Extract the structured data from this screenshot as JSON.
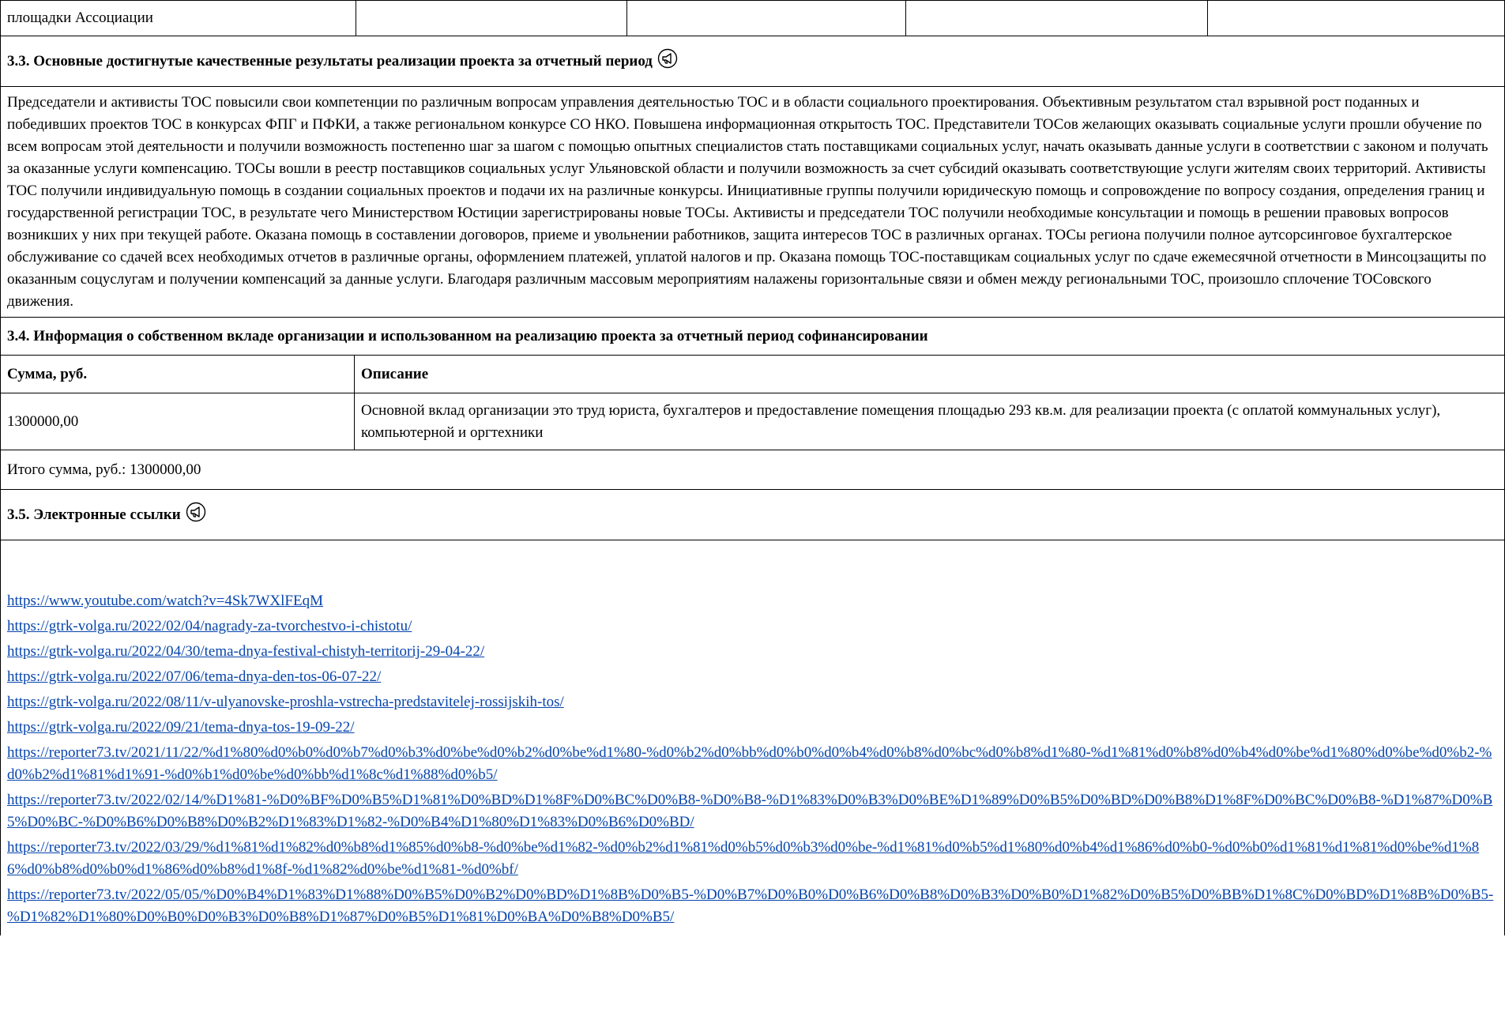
{
  "top_row": {
    "label": "площадки Ассоциации",
    "cells": [
      "",
      "",
      "",
      ""
    ]
  },
  "section_3_3": {
    "title": "3.3. Основные достигнутые качественные результаты реализации проекта за отчетный период",
    "icon": "megaphone-circle-icon",
    "text": "Председатели и активисты ТОС повысили свои компетенции по различным вопросам управления деятельностью ТОС и в области социального проектирования. Объективным результатом стал взрывной рост поданных и победивших проектов ТОС в конкурсах ФПГ и ПФКИ, а также региональном конкурсе СО НКО. Повышена информационная открытость ТОС. Представители ТОСов желающих оказывать социальные услуги прошли обучение по всем вопросам этой деятельности и получили возможность постепенно шаг за шагом с помощью опытных специалистов стать поставщиками социальных услуг, начать оказывать данные услуги в соответствии с законом и получать за оказанные услуги компенсацию. ТОСы вошли в реестр поставщиков социальных услуг Ульяновской области и получили возможность за счет субсидий оказывать соответствующие услуги жителям своих территорий. Активисты ТОС получили индивидуальную помощь в создании социальных проектов и подачи их на различные конкурсы. Инициативные группы получили юридическую помощь и сопровождение по вопросу создания, определения границ и государственной регистрации ТОС, в результате чего Министерством Юстиции зарегистрированы новые ТОСы. Активисты и председатели ТОС получили необходимые консультации и помощь в решении правовых вопросов возникших у них при текущей работе. Оказана помощь в составлении договоров, приеме и увольнении работников, защита интересов ТОС в различных органах. ТОСы региона получили полное аутсорсинговое бухгалтерское обслуживание со сдачей всех необходимых отчетов в различные органы, оформлением платежей, уплатой налогов и пр. Оказана помощь ТОС-поставщикам социальных услуг по сдаче ежемесячной отчетности в Минсоцзащиты по оказанным соцуслугам и получении компенсаций за данные услуги. Благодаря различным массовым мероприятиям налажены горизонтальные связи и обмен между региональными ТОС, произошло сплочение ТОСовского движения."
  },
  "section_3_4": {
    "title": "3.4. Информация о собственном вкладе организации и использованном на реализацию проекта за отчетный период софинансировании",
    "col_sum": "Сумма, руб.",
    "col_desc": "Описание",
    "rows": [
      {
        "sum": "1300000,00",
        "desc": "Основной вклад организации это труд юриста, бухгалтеров и предоставление помещения площадью 293 кв.м. для реализации проекта (с оплатой коммунальных услуг), компьютерной и оргтехники"
      }
    ],
    "total": "Итого сумма, руб.: 1300000,00"
  },
  "section_3_5": {
    "title": "3.5. Электронные ссылки",
    "icon": "megaphone-circle-icon",
    "links": [
      "https://www.youtube.com/watch?v=4Sk7WXlFEqM",
      "https://gtrk-volga.ru/2022/02/04/nagrady-za-tvorchestvo-i-chistotu/",
      "https://gtrk-volga.ru/2022/04/30/tema-dnya-festival-chistyh-territorij-29-04-22/",
      "https://gtrk-volga.ru/2022/07/06/tema-dnya-den-tos-06-07-22/",
      "https://gtrk-volga.ru/2022/08/11/v-ulyanovske-proshla-vstrecha-predstavitelej-rossijskih-tos/",
      "https://gtrk-volga.ru/2022/09/21/tema-dnya-tos-19-09-22/",
      "https://reporter73.tv/2021/11/22/%d1%80%d0%b0%d0%b7%d0%b3%d0%be%d0%b2%d0%be%d1%80-%d0%b2%d0%bb%d0%b0%d0%b4%d0%b8%d0%bc%d0%b8%d1%80-%d1%81%d0%b8%d0%b4%d0%be%d1%80%d0%be%d0%b2-%d0%b2%d1%81%d1%91-%d0%b1%d0%be%d0%bb%d1%8c%d1%88%d0%b5/",
      "https://reporter73.tv/2022/02/14/%D1%81-%D0%BF%D0%B5%D1%81%D0%BD%D1%8F%D0%BC%D0%B8-%D0%B8-%D1%83%D0%B3%D0%BE%D1%89%D0%B5%D0%BD%D0%B8%D1%8F%D0%BC%D0%B8-%D1%87%D0%B5%D0%BC-%D0%B6%D0%B8%D0%B2%D1%83%D1%82-%D0%B4%D1%80%D1%83%D0%B6%D0%BD/",
      "https://reporter73.tv/2022/03/29/%d1%81%d1%82%d0%b8%d1%85%d0%b8-%d0%be%d1%82-%d0%b2%d1%81%d0%b5%d0%b3%d0%be-%d1%81%d0%b5%d1%80%d0%b4%d1%86%d0%b0-%d0%b0%d1%81%d1%81%d0%be%d1%86%d0%b8%d0%b0%d1%86%d0%b8%d1%8f-%d1%82%d0%be%d1%81-%d0%bf/",
      "https://reporter73.tv/2022/05/05/%D0%B4%D1%83%D1%88%D0%B5%D0%B2%D0%BD%D1%8B%D0%B5-%D0%B7%D0%B0%D0%B6%D0%B8%D0%B3%D0%B0%D1%82%D0%B5%D0%BB%D1%8C%D0%BD%D1%8B%D0%B5-%D1%82%D1%80%D0%B0%D0%B3%D0%B8%D1%87%D0%B5%D1%81%D0%BA%D0%B8%D0%B5/"
    ]
  },
  "colors": {
    "link": "#0645ad",
    "border": "#000000",
    "text": "#000000"
  }
}
